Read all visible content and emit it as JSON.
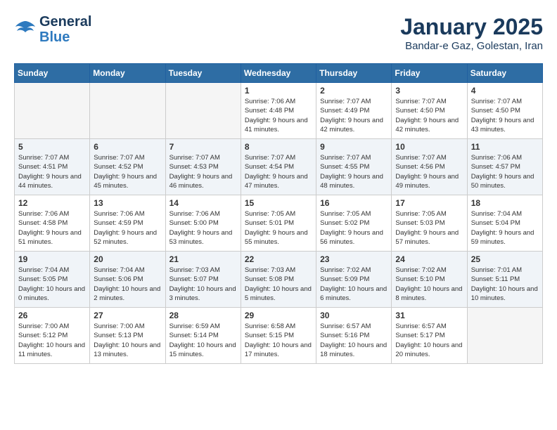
{
  "header": {
    "logo_line1": "General",
    "logo_line2": "Blue",
    "title": "January 2025",
    "subtitle": "Bandar-e Gaz, Golestan, Iran"
  },
  "weekdays": [
    "Sunday",
    "Monday",
    "Tuesday",
    "Wednesday",
    "Thursday",
    "Friday",
    "Saturday"
  ],
  "weeks": [
    [
      {
        "day": "",
        "info": ""
      },
      {
        "day": "",
        "info": ""
      },
      {
        "day": "",
        "info": ""
      },
      {
        "day": "1",
        "info": "Sunrise: 7:06 AM\nSunset: 4:48 PM\nDaylight: 9 hours and 41 minutes."
      },
      {
        "day": "2",
        "info": "Sunrise: 7:07 AM\nSunset: 4:49 PM\nDaylight: 9 hours and 42 minutes."
      },
      {
        "day": "3",
        "info": "Sunrise: 7:07 AM\nSunset: 4:50 PM\nDaylight: 9 hours and 42 minutes."
      },
      {
        "day": "4",
        "info": "Sunrise: 7:07 AM\nSunset: 4:50 PM\nDaylight: 9 hours and 43 minutes."
      }
    ],
    [
      {
        "day": "5",
        "info": "Sunrise: 7:07 AM\nSunset: 4:51 PM\nDaylight: 9 hours and 44 minutes."
      },
      {
        "day": "6",
        "info": "Sunrise: 7:07 AM\nSunset: 4:52 PM\nDaylight: 9 hours and 45 minutes."
      },
      {
        "day": "7",
        "info": "Sunrise: 7:07 AM\nSunset: 4:53 PM\nDaylight: 9 hours and 46 minutes."
      },
      {
        "day": "8",
        "info": "Sunrise: 7:07 AM\nSunset: 4:54 PM\nDaylight: 9 hours and 47 minutes."
      },
      {
        "day": "9",
        "info": "Sunrise: 7:07 AM\nSunset: 4:55 PM\nDaylight: 9 hours and 48 minutes."
      },
      {
        "day": "10",
        "info": "Sunrise: 7:07 AM\nSunset: 4:56 PM\nDaylight: 9 hours and 49 minutes."
      },
      {
        "day": "11",
        "info": "Sunrise: 7:06 AM\nSunset: 4:57 PM\nDaylight: 9 hours and 50 minutes."
      }
    ],
    [
      {
        "day": "12",
        "info": "Sunrise: 7:06 AM\nSunset: 4:58 PM\nDaylight: 9 hours and 51 minutes."
      },
      {
        "day": "13",
        "info": "Sunrise: 7:06 AM\nSunset: 4:59 PM\nDaylight: 9 hours and 52 minutes."
      },
      {
        "day": "14",
        "info": "Sunrise: 7:06 AM\nSunset: 5:00 PM\nDaylight: 9 hours and 53 minutes."
      },
      {
        "day": "15",
        "info": "Sunrise: 7:05 AM\nSunset: 5:01 PM\nDaylight: 9 hours and 55 minutes."
      },
      {
        "day": "16",
        "info": "Sunrise: 7:05 AM\nSunset: 5:02 PM\nDaylight: 9 hours and 56 minutes."
      },
      {
        "day": "17",
        "info": "Sunrise: 7:05 AM\nSunset: 5:03 PM\nDaylight: 9 hours and 57 minutes."
      },
      {
        "day": "18",
        "info": "Sunrise: 7:04 AM\nSunset: 5:04 PM\nDaylight: 9 hours and 59 minutes."
      }
    ],
    [
      {
        "day": "19",
        "info": "Sunrise: 7:04 AM\nSunset: 5:05 PM\nDaylight: 10 hours and 0 minutes."
      },
      {
        "day": "20",
        "info": "Sunrise: 7:04 AM\nSunset: 5:06 PM\nDaylight: 10 hours and 2 minutes."
      },
      {
        "day": "21",
        "info": "Sunrise: 7:03 AM\nSunset: 5:07 PM\nDaylight: 10 hours and 3 minutes."
      },
      {
        "day": "22",
        "info": "Sunrise: 7:03 AM\nSunset: 5:08 PM\nDaylight: 10 hours and 5 minutes."
      },
      {
        "day": "23",
        "info": "Sunrise: 7:02 AM\nSunset: 5:09 PM\nDaylight: 10 hours and 6 minutes."
      },
      {
        "day": "24",
        "info": "Sunrise: 7:02 AM\nSunset: 5:10 PM\nDaylight: 10 hours and 8 minutes."
      },
      {
        "day": "25",
        "info": "Sunrise: 7:01 AM\nSunset: 5:11 PM\nDaylight: 10 hours and 10 minutes."
      }
    ],
    [
      {
        "day": "26",
        "info": "Sunrise: 7:00 AM\nSunset: 5:12 PM\nDaylight: 10 hours and 11 minutes."
      },
      {
        "day": "27",
        "info": "Sunrise: 7:00 AM\nSunset: 5:13 PM\nDaylight: 10 hours and 13 minutes."
      },
      {
        "day": "28",
        "info": "Sunrise: 6:59 AM\nSunset: 5:14 PM\nDaylight: 10 hours and 15 minutes."
      },
      {
        "day": "29",
        "info": "Sunrise: 6:58 AM\nSunset: 5:15 PM\nDaylight: 10 hours and 17 minutes."
      },
      {
        "day": "30",
        "info": "Sunrise: 6:57 AM\nSunset: 5:16 PM\nDaylight: 10 hours and 18 minutes."
      },
      {
        "day": "31",
        "info": "Sunrise: 6:57 AM\nSunset: 5:17 PM\nDaylight: 10 hours and 20 minutes."
      },
      {
        "day": "",
        "info": ""
      }
    ]
  ]
}
